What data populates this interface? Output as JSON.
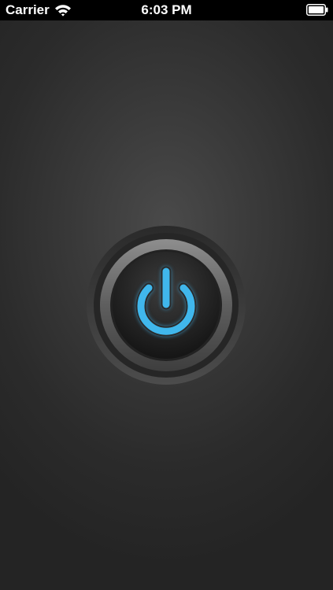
{
  "status_bar": {
    "carrier": "Carrier",
    "time": "6:03 PM",
    "icons": [
      "wifi-icon",
      "battery-icon"
    ]
  },
  "power_button": {
    "icon": "power-icon",
    "accent_color": "#3fb7ec"
  }
}
